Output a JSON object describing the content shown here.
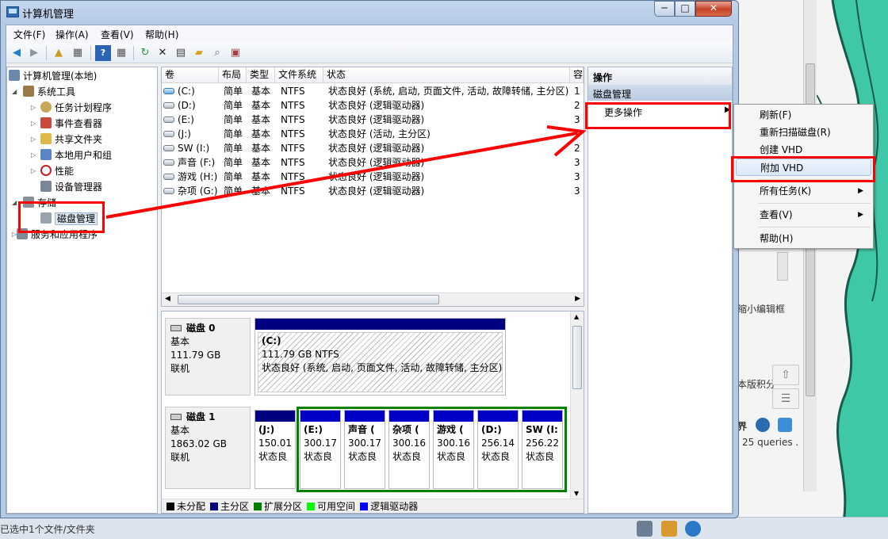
{
  "window": {
    "title": "计算机管理",
    "controls": {
      "minimize": "─",
      "maximize": "□",
      "close": "✕"
    }
  },
  "menu": [
    "文件(F)",
    "操作(A)",
    "查看(V)",
    "帮助(H)"
  ],
  "tree": {
    "root": "计算机管理(本地)",
    "system_tools": "系统工具",
    "task_scheduler": "任务计划程序",
    "event_viewer": "事件查看器",
    "shared_folders": "共享文件夹",
    "local_users": "本地用户和组",
    "performance": "性能",
    "device_manager": "设备管理器",
    "storage": "存储",
    "disk_management": "磁盘管理",
    "services_apps": "服务和应用程序"
  },
  "volume_list": {
    "headers": [
      "卷",
      "布局",
      "类型",
      "文件系统",
      "状态",
      "容"
    ],
    "rows": [
      {
        "vol": "(C:)",
        "layout": "简单",
        "type": "基本",
        "fs": "NTFS",
        "status": "状态良好 (系统, 启动, 页面文件, 活动, 故障转储, 主分区)",
        "cap": "1"
      },
      {
        "vol": "(D:)",
        "layout": "简单",
        "type": "基本",
        "fs": "NTFS",
        "status": "状态良好 (逻辑驱动器)",
        "cap": "2"
      },
      {
        "vol": "(E:)",
        "layout": "简单",
        "type": "基本",
        "fs": "NTFS",
        "status": "状态良好 (逻辑驱动器)",
        "cap": "3"
      },
      {
        "vol": "(J:)",
        "layout": "简单",
        "type": "基本",
        "fs": "NTFS",
        "status": "状态良好 (活动, 主分区)",
        "cap": "1"
      },
      {
        "vol": "SW (I:)",
        "layout": "简单",
        "type": "基本",
        "fs": "NTFS",
        "status": "状态良好 (逻辑驱动器)",
        "cap": "2"
      },
      {
        "vol": "声音 (F:)",
        "layout": "简单",
        "type": "基本",
        "fs": "NTFS",
        "status": "状态良好 (逻辑驱动器)",
        "cap": "3"
      },
      {
        "vol": "游戏 (H:)",
        "layout": "简单",
        "type": "基本",
        "fs": "NTFS",
        "status": "状态良好 (逻辑驱动器)",
        "cap": "3"
      },
      {
        "vol": "杂项 (G:)",
        "layout": "简单",
        "type": "基本",
        "fs": "NTFS",
        "status": "状态良好 (逻辑驱动器)",
        "cap": "3"
      }
    ]
  },
  "disks": {
    "disk0": {
      "name": "磁盘 0",
      "kind": "基本",
      "size": "111.79 GB",
      "state": "联机",
      "part_c": {
        "name": "(C:)",
        "size": "111.79 GB NTFS",
        "status": "状态良好 (系统, 启动, 页面文件, 活动, 故障转储, 主分区)"
      }
    },
    "disk1": {
      "name": "磁盘 1",
      "kind": "基本",
      "size": "1863.02 GB",
      "state": "联机",
      "parts": [
        {
          "name": "(J:)",
          "size": "150.01",
          "status": "状态良"
        },
        {
          "name": "(E:)",
          "size": "300.17",
          "status": "状态良"
        },
        {
          "name": "声音 (",
          "size": "300.17",
          "status": "状态良"
        },
        {
          "name": "杂项 (",
          "size": "300.16",
          "status": "状态良"
        },
        {
          "name": "游戏 (",
          "size": "300.16",
          "status": "状态良"
        },
        {
          "name": "(D:)",
          "size": "256.14",
          "status": "状态良"
        },
        {
          "name": "SW (I:",
          "size": "256.22",
          "status": "状态良"
        }
      ]
    }
  },
  "legend": [
    "未分配",
    "主分区",
    "扩展分区",
    "可用空间",
    "逻辑驱动器"
  ],
  "legend_colors": [
    "#000000",
    "#000080",
    "#008000",
    "#00ff00",
    "#0000ff"
  ],
  "actions": {
    "header": "操作",
    "section": "磁盘管理",
    "more": "更多操作"
  },
  "context_menu": {
    "refresh": "刷新(F)",
    "rescan": "重新扫描磁盘(R)",
    "create_vhd": "创建 VHD",
    "attach_vhd": "附加 VHD",
    "all_tasks": "所有任务(K)",
    "view": "查看(V)",
    "help": "帮助(H)"
  },
  "background": {
    "text_edit": "缩小编辑框",
    "text_ver": "本版积分",
    "text_jie": "界",
    "text_queries": "25 queries .",
    "status": "已选中1个文件/文件夹"
  },
  "annotation_color": "#ff0000"
}
